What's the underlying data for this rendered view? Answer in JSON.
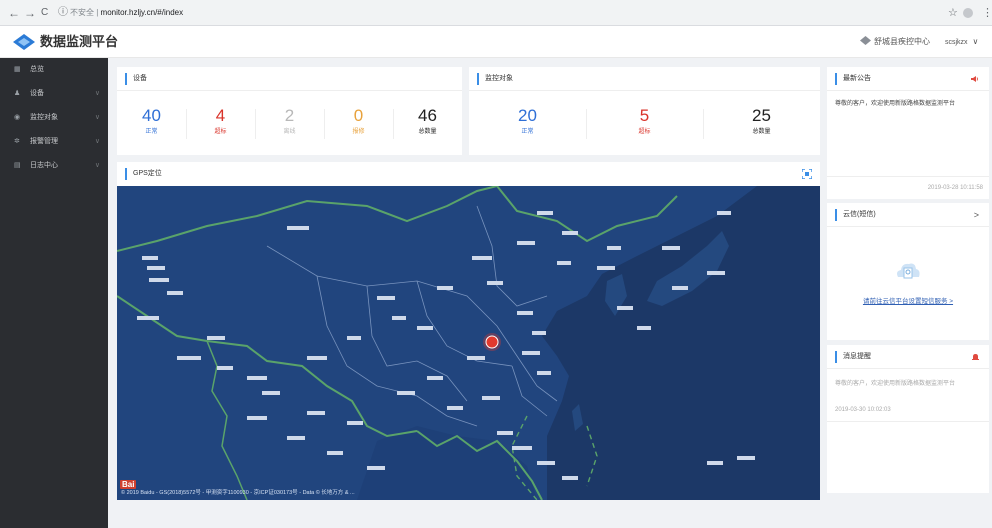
{
  "browser": {
    "back": "←",
    "forward": "→",
    "reload": "C",
    "info": "ⓘ",
    "security": "不安全",
    "separator": "|",
    "url": "monitor.hzljy.cn/#/index",
    "star": "☆",
    "menu": "⋮"
  },
  "header": {
    "title": "数据监测平台",
    "org": "舒城县疾控中心",
    "user": "scsjkzx",
    "user_caret": "∨"
  },
  "sidebar": {
    "items": [
      {
        "icon": "▦",
        "label": "总览"
      },
      {
        "icon": "♟",
        "label": "设备",
        "chev": "∨"
      },
      {
        "icon": "◉",
        "label": "监控对象",
        "chev": "∨"
      },
      {
        "icon": "✲",
        "label": "报警管理",
        "chev": "∨"
      },
      {
        "icon": "▤",
        "label": "日志中心",
        "chev": "∨"
      }
    ]
  },
  "devices": {
    "title": "设备",
    "stats": [
      {
        "value": "40",
        "label": "正常",
        "color": "#2f6fd6"
      },
      {
        "value": "4",
        "label": "超标",
        "color": "#d9332a"
      },
      {
        "value": "2",
        "label": "离线",
        "color": "#b8b8b8"
      },
      {
        "value": "0",
        "label": "报修",
        "color": "#e8a23c"
      },
      {
        "value": "46",
        "label": "总数量",
        "color": "#222222"
      }
    ]
  },
  "monitored": {
    "title": "监控对象",
    "stats": [
      {
        "value": "20",
        "label": "正常",
        "color": "#2f6fd6"
      },
      {
        "value": "5",
        "label": "超标",
        "color": "#d9332a"
      },
      {
        "value": "25",
        "label": "总数量",
        "color": "#222222"
      }
    ]
  },
  "gps": {
    "title": "GPS定位",
    "baidu": "Bai",
    "copyright": "© 2019 Baidu - GS(2018)5572号 - 甲测资字1100930 - 京ICP证030173号 - Data © 长地万方 & ..."
  },
  "notice": {
    "title": "最新公告",
    "text": "尊敬的客户，欢迎使用新版路格数据监测平台",
    "time": "2019-03-28 10:11:58"
  },
  "sms": {
    "title": "云信(短信)",
    "chev": ">",
    "link": "请前往云信平台设置短信服务 >"
  },
  "messages": {
    "title": "消息提醒",
    "text": "尊敬的客户，欢迎使用新版路格数据监测平台",
    "time": "2019-03-30 10:02:03"
  },
  "colors": {
    "accent": "#3a8ee6",
    "sidebar_bg": "#2b2d31",
    "map_sea": "#1f3f74",
    "map_land": "#1b3b6e",
    "marker": "#e23a2e"
  }
}
